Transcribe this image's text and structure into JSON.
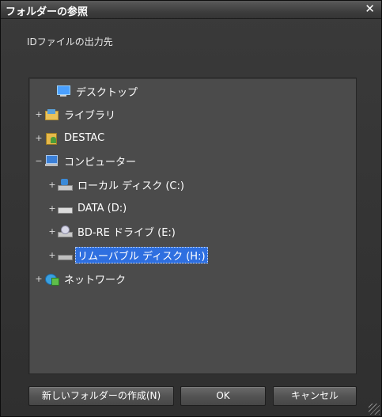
{
  "window": {
    "title": "フォルダーの参照",
    "close_glyph": "✕"
  },
  "description": "IDファイルの出力先",
  "tree": [
    {
      "label": "デスクトップ",
      "expander": "",
      "icon": "desktop-icon"
    },
    {
      "label": "ライブラリ",
      "expander": "+",
      "icon": "library-icon"
    },
    {
      "label": "DESTAC",
      "expander": "+",
      "icon": "user-folder-icon"
    },
    {
      "label": "コンピューター",
      "expander": "−",
      "icon": "computer-icon"
    },
    {
      "label": "ローカル ディスク (C:)",
      "expander": "+",
      "icon": "system-drive-icon"
    },
    {
      "label": "DATA (D:)",
      "expander": "+",
      "icon": "drive-icon"
    },
    {
      "label": "BD-RE ドライブ (E:)",
      "expander": "+",
      "icon": "bd-drive-icon"
    },
    {
      "label": "リムーバブル ディスク (H:)",
      "expander": "+",
      "icon": "removable-drive-icon",
      "selected": true
    },
    {
      "label": "ネットワーク",
      "expander": "+",
      "icon": "network-icon"
    }
  ],
  "buttons": {
    "new_folder": "新しいフォルダーの作成(N)",
    "ok": "OK",
    "cancel": "キャンセル"
  },
  "colors": {
    "background": "#2d2d2d",
    "tree_background": "#4b4b4b",
    "selection": "#2e6fe0"
  }
}
